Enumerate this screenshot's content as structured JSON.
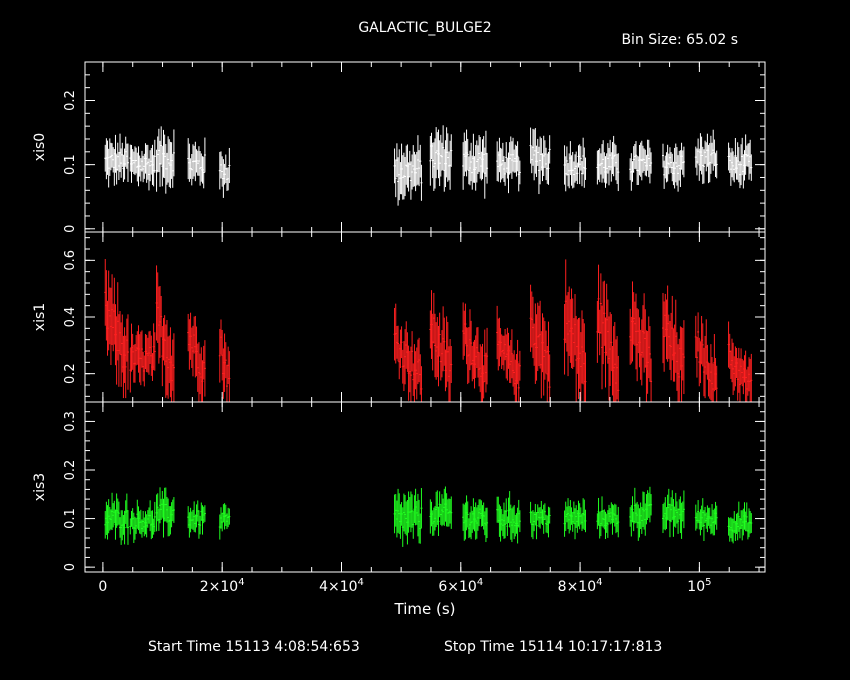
{
  "title": "GALACTIC_BULGE2",
  "bin_size_label": "Bin Size: 65.02 s",
  "xlabel": "Time (s)",
  "start_time_label": "Start Time 15113  4:08:54:653",
  "stop_time_label": "Stop Time 15114 10:17:17:813",
  "colors": {
    "xis0": "#ffffff",
    "xis1": "#ff2020",
    "xis3": "#20ff20",
    "axes": "#ffffff",
    "background": "#000000"
  },
  "chart_data": {
    "type": "scatter",
    "subtype": "stacked light curves with error bars",
    "title": "GALACTIC_BULGE2",
    "xlabel": "Time (s)",
    "xlim": [
      -3000,
      111000
    ],
    "x_ticks": [
      {
        "value": 0,
        "label": "0"
      },
      {
        "value": 20000,
        "label": "2×10^4"
      },
      {
        "value": 40000,
        "label": "4×10^4"
      },
      {
        "value": 60000,
        "label": "6×10^4"
      },
      {
        "value": 80000,
        "label": "8×10^4"
      },
      {
        "value": 100000,
        "label": "10^5"
      }
    ],
    "panels": [
      {
        "name": "xis0",
        "ylabel": "xis0",
        "color": "#ffffff",
        "ylim": [
          -0.005,
          0.26
        ],
        "y_ticks": [
          {
            "value": 0,
            "label": "0"
          },
          {
            "value": 0.1,
            "label": "0.1"
          },
          {
            "value": 0.2,
            "label": "0.2"
          }
        ],
        "segments": [
          {
            "x": [
              500,
              1000,
              2500,
              4200,
              7800,
              9000,
              11800,
              16700,
              19400,
              21500,
              23000,
              49500,
              52500,
              57900,
              65600,
              72700,
              75700,
              79500,
              84500,
              89500,
              94500,
              99500,
              103500,
              107500
            ],
            "y": [
              0.1
            ]
          },
          {
            "x": [
              1000,
              3500
            ],
            "y": [
              0.11
            ]
          }
        ],
        "data": [
          {
            "start": 300,
            "end": 4300,
            "mean": 0.105,
            "amp": 0.02
          },
          {
            "start": 4500,
            "end": 8800,
            "mean": 0.1,
            "amp": 0.02
          },
          {
            "start": 8900,
            "end": 12000,
            "mean": 0.11,
            "amp": 0.025
          },
          {
            "start": 14200,
            "end": 17200,
            "mean": 0.1,
            "amp": 0.02
          },
          {
            "start": 19500,
            "end": 21300,
            "mean": 0.09,
            "amp": 0.02
          },
          {
            "start": 48800,
            "end": 53500,
            "mean": 0.09,
            "amp": 0.025
          },
          {
            "start": 54800,
            "end": 58500,
            "mean": 0.11,
            "amp": 0.025
          },
          {
            "start": 60300,
            "end": 64500,
            "mean": 0.105,
            "amp": 0.025
          },
          {
            "start": 66000,
            "end": 70000,
            "mean": 0.1,
            "amp": 0.02
          },
          {
            "start": 71600,
            "end": 75000,
            "mean": 0.11,
            "amp": 0.025
          },
          {
            "start": 77300,
            "end": 81000,
            "mean": 0.1,
            "amp": 0.02
          },
          {
            "start": 82800,
            "end": 86500,
            "mean": 0.1,
            "amp": 0.02
          },
          {
            "start": 88300,
            "end": 92000,
            "mean": 0.1,
            "amp": 0.02
          },
          {
            "start": 93800,
            "end": 97500,
            "mean": 0.1,
            "amp": 0.02
          },
          {
            "start": 99300,
            "end": 103000,
            "mean": 0.11,
            "amp": 0.02
          },
          {
            "start": 104800,
            "end": 108800,
            "mean": 0.1,
            "amp": 0.02
          }
        ]
      },
      {
        "name": "xis1",
        "ylabel": "xis1",
        "color": "#ff2020",
        "ylim": [
          0.1,
          0.7
        ],
        "y_ticks": [
          {
            "value": 0.2,
            "label": "0.2"
          },
          {
            "value": 0.4,
            "label": "0.4"
          },
          {
            "value": 0.6,
            "label": "0.6"
          }
        ],
        "data": [
          {
            "start": 300,
            "end": 4300,
            "mean": 0.33,
            "amp": 0.09,
            "decay": true
          },
          {
            "start": 4500,
            "end": 8800,
            "mean": 0.25,
            "amp": 0.06
          },
          {
            "start": 8900,
            "end": 12000,
            "mean": 0.3,
            "amp": 0.09,
            "decay": true
          },
          {
            "start": 14200,
            "end": 17200,
            "mean": 0.27,
            "amp": 0.07,
            "decay": true
          },
          {
            "start": 19500,
            "end": 21300,
            "mean": 0.23,
            "amp": 0.07,
            "decay": true
          },
          {
            "start": 48800,
            "end": 53500,
            "mean": 0.25,
            "amp": 0.07,
            "decay": true
          },
          {
            "start": 54800,
            "end": 58500,
            "mean": 0.28,
            "amp": 0.08,
            "decay": true
          },
          {
            "start": 60300,
            "end": 64500,
            "mean": 0.27,
            "amp": 0.07,
            "decay": true
          },
          {
            "start": 66000,
            "end": 70000,
            "mean": 0.24,
            "amp": 0.06,
            "decay": true
          },
          {
            "start": 71600,
            "end": 75000,
            "mean": 0.3,
            "amp": 0.09,
            "decay": true
          },
          {
            "start": 77300,
            "end": 81000,
            "mean": 0.3,
            "amp": 0.1,
            "decay": true
          },
          {
            "start": 82800,
            "end": 86500,
            "mean": 0.31,
            "amp": 0.1,
            "decay": true
          },
          {
            "start": 88300,
            "end": 92000,
            "mean": 0.3,
            "amp": 0.09,
            "decay": true
          },
          {
            "start": 93800,
            "end": 97500,
            "mean": 0.28,
            "amp": 0.09,
            "decay": true
          },
          {
            "start": 99300,
            "end": 103000,
            "mean": 0.24,
            "amp": 0.07,
            "decay": true
          },
          {
            "start": 104800,
            "end": 108800,
            "mean": 0.2,
            "amp": 0.06,
            "decay": true
          }
        ]
      },
      {
        "name": "xis3",
        "ylabel": "xis3",
        "color": "#20ff20",
        "ylim": [
          -0.01,
          0.34
        ],
        "y_ticks": [
          {
            "value": 0,
            "label": "0"
          },
          {
            "value": 0.1,
            "label": "0.1"
          },
          {
            "value": 0.2,
            "label": "0.2"
          },
          {
            "value": 0.3,
            "label": "0.3"
          }
        ],
        "data": [
          {
            "start": 300,
            "end": 4300,
            "mean": 0.1,
            "amp": 0.025
          },
          {
            "start": 4500,
            "end": 8800,
            "mean": 0.095,
            "amp": 0.02
          },
          {
            "start": 8900,
            "end": 12000,
            "mean": 0.11,
            "amp": 0.025
          },
          {
            "start": 14200,
            "end": 17200,
            "mean": 0.1,
            "amp": 0.02
          },
          {
            "start": 19500,
            "end": 21300,
            "mean": 0.095,
            "amp": 0.02
          },
          {
            "start": 48800,
            "end": 53500,
            "mean": 0.1,
            "amp": 0.03
          },
          {
            "start": 54800,
            "end": 58500,
            "mean": 0.11,
            "amp": 0.025
          },
          {
            "start": 60300,
            "end": 64500,
            "mean": 0.1,
            "amp": 0.025
          },
          {
            "start": 66000,
            "end": 70000,
            "mean": 0.1,
            "amp": 0.025
          },
          {
            "start": 71600,
            "end": 75000,
            "mean": 0.1,
            "amp": 0.02
          },
          {
            "start": 77300,
            "end": 81000,
            "mean": 0.1,
            "amp": 0.02
          },
          {
            "start": 82800,
            "end": 86500,
            "mean": 0.1,
            "amp": 0.02
          },
          {
            "start": 88300,
            "end": 92000,
            "mean": 0.11,
            "amp": 0.025
          },
          {
            "start": 93800,
            "end": 97500,
            "mean": 0.11,
            "amp": 0.025
          },
          {
            "start": 99300,
            "end": 103000,
            "mean": 0.1,
            "amp": 0.02
          },
          {
            "start": 104800,
            "end": 108800,
            "mean": 0.09,
            "amp": 0.02
          }
        ]
      }
    ]
  }
}
